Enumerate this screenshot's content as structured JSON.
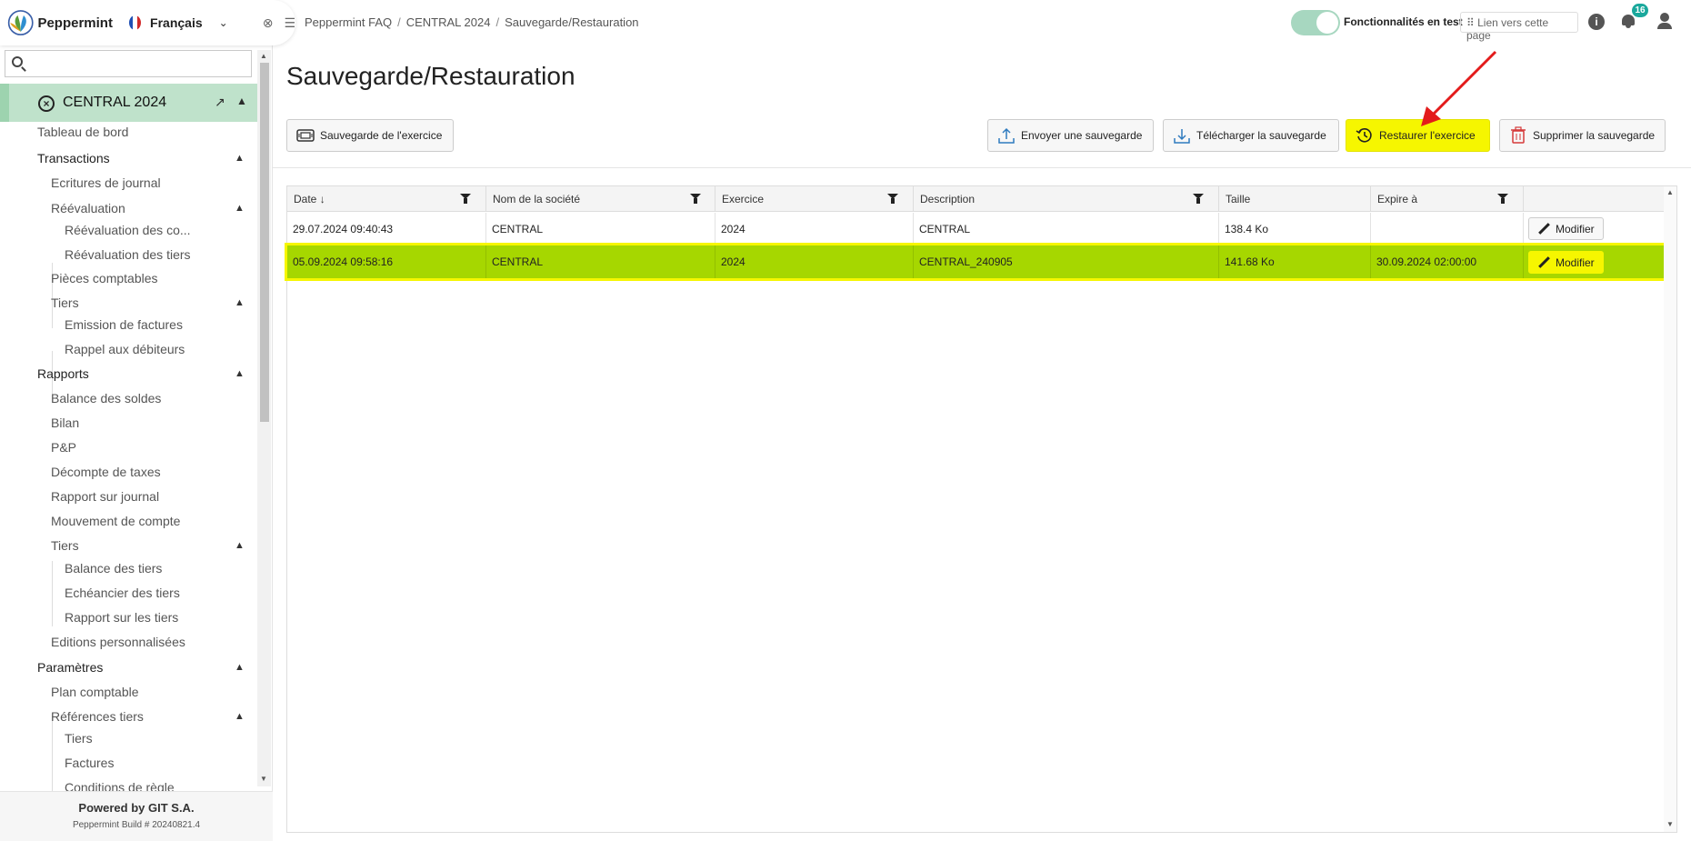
{
  "brand": {
    "name": "Peppermint",
    "language": "Français"
  },
  "search": {
    "placeholder": ""
  },
  "sidebar": {
    "active": "CENTRAL 2024",
    "items": [
      {
        "label": "Tableau de bord"
      },
      {
        "label": "Transactions"
      },
      {
        "label": "Ecritures de journal"
      },
      {
        "label": "Réévaluation"
      },
      {
        "label": "Réévaluation des co..."
      },
      {
        "label": "Réévaluation des tiers"
      },
      {
        "label": "Pièces comptables"
      },
      {
        "label": "Tiers"
      },
      {
        "label": "Emission de factures"
      },
      {
        "label": "Rappel aux débiteurs"
      },
      {
        "label": "Rapports"
      },
      {
        "label": "Balance des soldes"
      },
      {
        "label": "Bilan"
      },
      {
        "label": "P&P"
      },
      {
        "label": "Décompte de taxes"
      },
      {
        "label": "Rapport sur journal"
      },
      {
        "label": "Mouvement de compte"
      },
      {
        "label": "Tiers"
      },
      {
        "label": "Balance des tiers"
      },
      {
        "label": "Echéancier des tiers"
      },
      {
        "label": "Rapport sur les tiers"
      },
      {
        "label": "Editions personnalisées"
      },
      {
        "label": "Paramètres"
      },
      {
        "label": "Plan comptable"
      },
      {
        "label": "Références tiers"
      },
      {
        "label": "Tiers"
      },
      {
        "label": "Factures"
      },
      {
        "label": "Conditions de règle"
      }
    ]
  },
  "footer": {
    "powered": "Powered by GIT S.A.",
    "build": "Peppermint Build # 20240821.4"
  },
  "breadcrumb": {
    "root": "Peppermint FAQ",
    "company": "CENTRAL 2024",
    "page": "Sauvegarde/Restauration"
  },
  "topbar": {
    "features_label": "Fonctionnalités en test",
    "link_label": "Lien vers cette page",
    "notifications": "16"
  },
  "page": {
    "title": "Sauvegarde/Restauration"
  },
  "toolbar": {
    "backup": "Sauvegarde de l'exercice",
    "upload": "Envoyer une sauvegarde",
    "download": "Télécharger la sauvegarde",
    "restore": "Restaurer l'exercice",
    "delete": "Supprimer la sauvegarde"
  },
  "table": {
    "columns": [
      "Date",
      "Nom de la société",
      "Exercice",
      "Description",
      "Taille",
      "Expire à"
    ],
    "sort_indicator": "↓",
    "rows": [
      {
        "date": "29.07.2024 09:40:43",
        "company": "CENTRAL",
        "year": "2024",
        "description": "CENTRAL",
        "size": "138.4 Ko",
        "expires": "",
        "action": "Modifier"
      },
      {
        "date": "05.09.2024 09:58:16",
        "company": "CENTRAL",
        "year": "2024",
        "description": "CENTRAL_240905",
        "size": "141.68 Ko",
        "expires": "30.09.2024 02:00:00",
        "action": "Modifier"
      }
    ]
  },
  "colors": {
    "accent": "#1aa89c",
    "highlight": "#f6f600",
    "selected_row": "#a6d700",
    "active_nav": "#bfe2cb"
  }
}
